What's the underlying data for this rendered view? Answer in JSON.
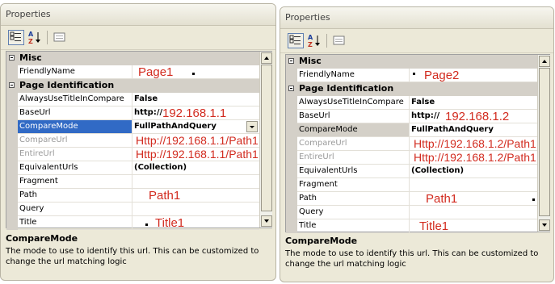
{
  "colors": {
    "panel_bg": "#ece9d8",
    "selection": "#316ac5",
    "annotation": "#d22b1f",
    "category_bg": "#d4d0c8"
  },
  "icons": {
    "categorized": "categorized-view-icon",
    "alphabetical": "alphabetical-sort-icon",
    "pages": "property-pages-icon"
  },
  "left": {
    "title": "Properties",
    "cat_misc": "Misc",
    "cat_page": "Page Identification",
    "props": {
      "friendly": "FriendlyName",
      "always": "AlwaysUseTitleInCompare",
      "base": "BaseUrl",
      "mode": "CompareMode",
      "cmpurl": "CompareUrl",
      "entire": "EntireUrl",
      "equiv": "EquivalentUrls",
      "frag": "Fragment",
      "path": "Path",
      "query": "Query",
      "title": "Title"
    },
    "values": {
      "always": "False",
      "base_prefix": "http://",
      "mode": "FullPathAndQuery",
      "equiv": "(Collection)"
    },
    "annotations": {
      "friendly": "Page1",
      "base": "192.168.1.1",
      "cmpurl": "Http://192.168.1.1/Path1",
      "entire": "Http://192.168.1.1/Path1",
      "path": "Path1",
      "title": "Title1"
    },
    "description": {
      "title": "CompareMode",
      "text": "The mode to use to identify this url.  This can be customized to change the url matching logic"
    }
  },
  "right": {
    "title": "Properties",
    "cat_misc": "Misc",
    "cat_page": "Page Identification",
    "props": {
      "friendly": "FriendlyName",
      "always": "AlwaysUseTitleInCompare",
      "base": "BaseUrl",
      "mode": "CompareMode",
      "cmpurl": "CompareUrl",
      "entire": "EntireUrl",
      "equiv": "EquivalentUrls",
      "frag": "Fragment",
      "path": "Path",
      "query": "Query",
      "title": "Title"
    },
    "values": {
      "always": "False",
      "base_prefix": "http://",
      "mode": "FullPathAndQuery",
      "equiv": "(Collection)"
    },
    "annotations": {
      "friendly": "Page2",
      "base": "192.168.1.2",
      "cmpurl": "Http://192.168.1.2/Path1",
      "entire": "Http://192.168.1.2/Path1",
      "path": "Path1",
      "title": "Title1"
    },
    "description": {
      "title": "CompareMode",
      "text": "The mode to use to identify this url.  This can be customized to change the url matching logic"
    }
  }
}
